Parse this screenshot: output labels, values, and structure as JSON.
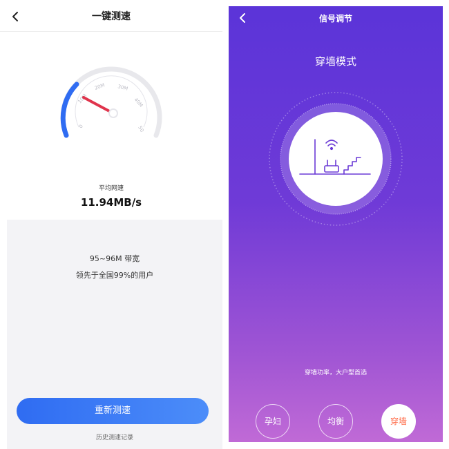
{
  "left": {
    "title": "一键测速",
    "gauge": {
      "ticks": [
        "0",
        "10M",
        "20M",
        "30M",
        "40M",
        "50"
      ]
    },
    "avg_label": "平均网速",
    "avg_value": "11.94MB/s",
    "bandwidth": "95~96M 带宽",
    "rank": "领先于全国99%的用户",
    "retest_button": "重新测速",
    "history_link": "历史测速记录"
  },
  "right": {
    "title": "信号调节",
    "mode_title": "穿墙模式",
    "mode_description": "穿墙功率，大户型首选",
    "modes": [
      {
        "label": "孕妇",
        "active": false
      },
      {
        "label": "均衡",
        "active": false
      },
      {
        "label": "穿墙",
        "active": true
      }
    ]
  },
  "colors": {
    "accent_blue": "#2f6cf2",
    "needle": "#e0344c",
    "purple_top": "#5b34d8",
    "purple_bottom": "#c06ad6",
    "active_mode_text": "#ff6d4a"
  }
}
